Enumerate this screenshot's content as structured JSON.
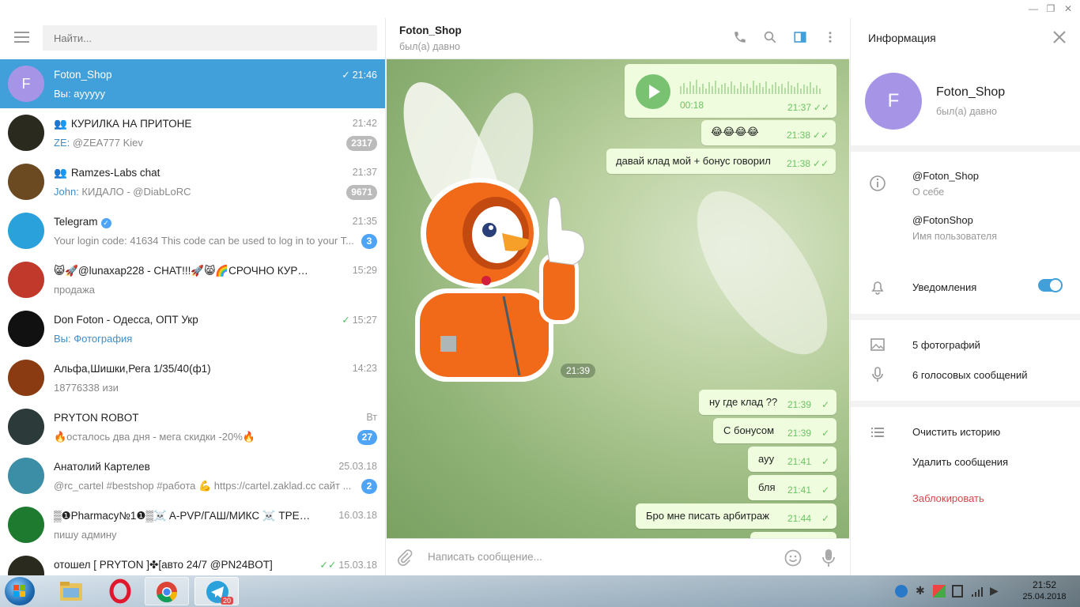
{
  "search": {
    "placeholder": "Найти..."
  },
  "dialogs": [
    {
      "name": "Foton_Shop",
      "time": "21:46",
      "from": "Вы: ",
      "msg": "ayyyyy",
      "avatar_letter": "F",
      "avatar_color": "#a695e7",
      "active": true,
      "check": "✓"
    },
    {
      "name": "КУРИЛКА НА ПРИТОНЕ",
      "time": "21:42",
      "from": "ZE: ",
      "msg": "@ZEA777 Kiev",
      "badge": "2317",
      "avatar_color": "#2a2a1e",
      "group": true
    },
    {
      "name": "Ramzes-Labs chat",
      "time": "21:37",
      "from": "John: ",
      "msg": "КИДАЛО - @DiabLoRC",
      "badge": "9671",
      "avatar_color": "#6b4a22",
      "group": true
    },
    {
      "name": "Telegram",
      "time": "21:35",
      "from": "",
      "msg": "Your login code: 41634  This code can be used to log in to your T...",
      "badge": "3",
      "avatar_color": "#2aa1da",
      "verified": true
    },
    {
      "name": "😸🚀@lunaxap228 - CHAT!!!🚀😸🌈СРОЧНО КУРЬЕРЫ...",
      "time": "15:29",
      "from": "",
      "msg": "продажа",
      "avatar_color": "#c0392b"
    },
    {
      "name": "Don Foton - Одесса, ОПТ Укр",
      "time": "15:27",
      "from": "Вы: ",
      "msg": "Фотография",
      "avatar_color": "#111111",
      "check": "✓",
      "msg_blue": true
    },
    {
      "name": "Альфа,Шишки,Рега 1/35/40(ф1)",
      "time": "14:23",
      "from": "",
      "msg": "18776338 изи",
      "avatar_color": "#8a3b12"
    },
    {
      "name": "PRYTON ROBOT",
      "time": "Вт",
      "from": "",
      "msg": "🔥осталось два дня - мега скидки -20%🔥",
      "badge": "27",
      "avatar_color": "#2c3a3a"
    },
    {
      "name": "Анатолий Картелев",
      "time": "25.03.18",
      "from": "",
      "msg": "@rc_cartel #bestshop #работа 💪 https://cartel.zaklad.cc сайт ...",
      "badge": "2",
      "avatar_color": "#3b8ea5"
    },
    {
      "name": "▒❶Pharmacy№1❶▒☠️ A-PVP/ГАШ/МИКС ☠️ ТРЕБУ...",
      "time": "16.03.18",
      "from": "",
      "msg": "пишу админу",
      "avatar_color": "#1e7a2e"
    },
    {
      "name": "отошел [ PRYTON ]✤[авто 24/7 @PN24BOT]",
      "time": "15.03.18",
      "from": "",
      "msg": "",
      "avatar_color": "#2a2a1e",
      "check": "✓✓"
    }
  ],
  "chat": {
    "title": "Foton_Shop",
    "status": "был(а) давно",
    "voice_duration": "00:18",
    "voice_time": "21:37",
    "sticker_time": "21:39",
    "messages": [
      {
        "text": "😂😂😂😂",
        "time": "21:38",
        "check": "✓✓"
      },
      {
        "text": "давай клад мой + бонус говорил",
        "time": "21:38",
        "check": "✓✓"
      },
      {
        "text": "ну где клад ??",
        "time": "21:39",
        "check": "✓"
      },
      {
        "text": "С бонусом",
        "time": "21:39",
        "check": "✓"
      },
      {
        "text": "ауу",
        "time": "21:41",
        "check": "✓"
      },
      {
        "text": "бля",
        "time": "21:41",
        "check": "✓"
      },
      {
        "text": "Бро мне писать арбитраж",
        "time": "21:44",
        "check": "✓"
      }
    ],
    "composer_placeholder": "Написать сообщение..."
  },
  "info": {
    "title": "Информация",
    "name": "Foton_Shop",
    "status": "был(а) давно",
    "avatar_letter": "F",
    "bio": "@Foton_Shop",
    "bio_label": "О себе",
    "username": "@FotonShop",
    "username_label": "Имя пользователя",
    "notifications": "Уведомления",
    "photos": "5 фотографий",
    "voice": "6 голосовых сообщений",
    "clear": "Очистить историю",
    "delete": "Удалить сообщения",
    "block": "Заблокировать"
  },
  "taskbar": {
    "time": "21:52",
    "date": "25.04.2018",
    "telegram_badge": "20"
  },
  "colors": {
    "accent": "#419fd9",
    "bubble": "#effdde",
    "check": "#4dbe5c",
    "danger": "#d24949"
  }
}
